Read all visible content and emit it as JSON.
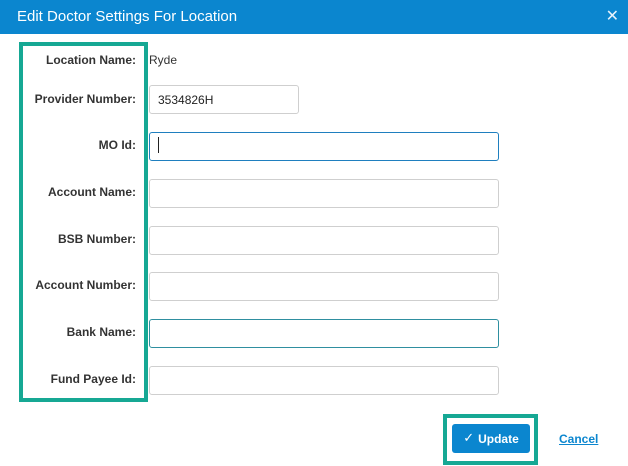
{
  "dialog": {
    "title": "Edit Doctor Settings For Location",
    "close_icon": "close-icon"
  },
  "form": {
    "location_name": {
      "label": "Location Name:",
      "value": "Ryde"
    },
    "provider_number": {
      "label": "Provider Number:",
      "value": "3534826H"
    },
    "mo_id": {
      "label": "MO Id:",
      "value": ""
    },
    "account_name": {
      "label": "Account Name:",
      "value": ""
    },
    "bsb_number": {
      "label": "BSB Number:",
      "value": ""
    },
    "account_number": {
      "label": "Account Number:",
      "value": ""
    },
    "bank_name": {
      "label": "Bank Name:",
      "value": ""
    },
    "fund_payee_id": {
      "label": "Fund Payee Id:",
      "value": ""
    }
  },
  "actions": {
    "update_label": "Update",
    "cancel_label": "Cancel"
  },
  "colors": {
    "header": "#0b86cf",
    "highlight": "#16a894",
    "link": "#0b86cf"
  }
}
